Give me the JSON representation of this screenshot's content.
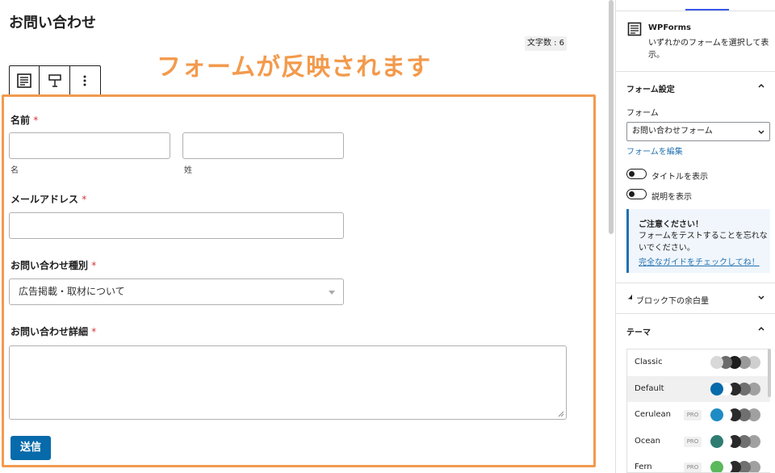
{
  "editor": {
    "page_title": "お問い合わせ",
    "char_count": "文字数 : 6",
    "annotation": "フォームが反映されます"
  },
  "form": {
    "name_label": "名前",
    "required_mark": "*",
    "first_sub": "名",
    "last_sub": "姓",
    "email_label": "メールアドレス",
    "type_label": "お問い合わせ種別",
    "type_selected": "広告掲載・取材について",
    "detail_label": "お問い合わせ詳細",
    "submit_label": "送信",
    "accent_color": "#f29a4e",
    "submit_color": "#066aab"
  },
  "sidebar": {
    "plugin_title": "WPForms",
    "plugin_desc": "いずれかのフォームを選択して表示。",
    "form_settings_title": "フォーム設定",
    "form_field_label": "フォーム",
    "form_selected": "お問い合わせフォーム",
    "edit_form_link": "フォームを編集",
    "toggle_title": "タイトルを表示",
    "toggle_desc": "説明を表示",
    "notice_title": "ご注意ください！",
    "notice_body": "フォームをテストすることを忘れないでください。",
    "notice_link": "完全なガイドをチェックしてね！",
    "spacing_title": "ブロック下の余白量",
    "theme_title": "テーマ",
    "pro_badge": "PRO",
    "themes": [
      {
        "name": "Classic",
        "pro": false,
        "selected": false,
        "colors": [
          "#d8d8d8",
          "#6b6b6b",
          "#1e1e1e",
          "#9a9a9a",
          "#cfcfcf"
        ]
      },
      {
        "name": "Default",
        "pro": false,
        "selected": true,
        "colors": [
          "#066aab",
          "#ffffff",
          "#2a2a2a",
          "#707070",
          "#a0a0a0"
        ]
      },
      {
        "name": "Cerulean",
        "pro": true,
        "selected": false,
        "colors": [
          "#1e8cc4",
          "#ffffff",
          "#2a2a2a",
          "#707070",
          "#a0a0a0"
        ]
      },
      {
        "name": "Ocean",
        "pro": true,
        "selected": false,
        "colors": [
          "#2f7c72",
          "#ffffff",
          "#2a2a2a",
          "#707070",
          "#a0a0a0"
        ]
      },
      {
        "name": "Fern",
        "pro": true,
        "selected": false,
        "colors": [
          "#5cb85c",
          "#ffffff",
          "#2a2a2a",
          "#707070",
          "#a0a0a0"
        ]
      }
    ]
  }
}
